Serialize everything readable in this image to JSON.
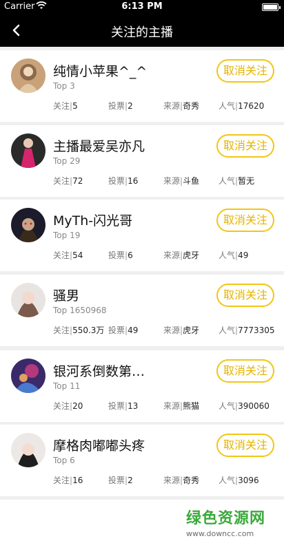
{
  "status": {
    "carrier": "Carrier",
    "time": "6:13 PM"
  },
  "nav": {
    "title": "关注的主播"
  },
  "labels": {
    "follow": "关注",
    "vote": "投票",
    "source": "来源",
    "popularity": "人气",
    "sep": "|"
  },
  "items": [
    {
      "name": "纯情小苹果^_^",
      "rank": "Top 3",
      "follow": "5",
      "vote": "2",
      "source": "奇秀",
      "popularity": "17620",
      "button": "取消关注"
    },
    {
      "name": "主播最爱吴亦凡",
      "rank": "Top 29",
      "follow": "72",
      "vote": "16",
      "source": "斗鱼",
      "popularity": "暂无",
      "button": "取消关注"
    },
    {
      "name": "MyTh-闪光哥",
      "rank": "Top 19",
      "follow": "54",
      "vote": "6",
      "source": "虎牙",
      "popularity": "49",
      "button": "取消关注"
    },
    {
      "name": "骚男",
      "rank": "Top 1650968",
      "follow": "550.3万",
      "vote": "49",
      "source": "虎牙",
      "popularity": "7773305",
      "button": "取消关注"
    },
    {
      "name": "银河系倒数第…",
      "rank": "Top 11",
      "follow": "20",
      "vote": "13",
      "source": "熊猫",
      "popularity": "390060",
      "button": "取消关注"
    },
    {
      "name": "摩格肉嘟嘟头疼",
      "rank": "Top 6",
      "follow": "16",
      "vote": "2",
      "source": "奇秀",
      "popularity": "3096",
      "button": "取消关注"
    }
  ],
  "watermark": {
    "title": "绿色资源网",
    "url": "www.downcc.com"
  },
  "colors": {
    "accent": "#f2c511",
    "bar": "#000000"
  }
}
